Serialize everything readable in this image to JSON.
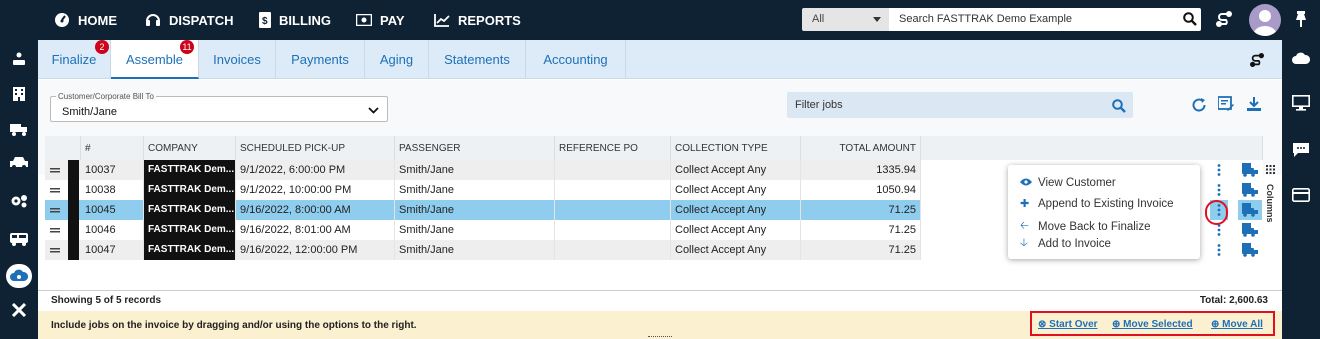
{
  "topnav": {
    "items": [
      {
        "label": "HOME",
        "icon": "speedometer-icon"
      },
      {
        "label": "DISPATCH",
        "icon": "headset-icon"
      },
      {
        "label": "BILLING",
        "icon": "document-dollar-icon"
      },
      {
        "label": "PAY",
        "icon": "money-icon"
      },
      {
        "label": "REPORTS",
        "icon": "chart-line-icon"
      }
    ],
    "search_category": "All",
    "search_placeholder": "Search FASTTRAK Demo Example"
  },
  "tabs": [
    {
      "label": "Finalize",
      "badge": "2"
    },
    {
      "label": "Assemble",
      "badge": "11",
      "active": true
    },
    {
      "label": "Invoices"
    },
    {
      "label": "Payments"
    },
    {
      "label": "Aging"
    },
    {
      "label": "Statements"
    },
    {
      "label": "Accounting"
    }
  ],
  "filters": {
    "customer_label": "Customer/Corporate Bill To",
    "customer_value": "Smith/Jane",
    "filter_placeholder": "Filter jobs"
  },
  "grid": {
    "columns": [
      "#",
      "COMPANY",
      "SCHEDULED PICK-UP",
      "PASSENGER",
      "REFERENCE PO",
      "COLLECTION TYPE",
      "TOTAL AMOUNT"
    ],
    "rows": [
      {
        "id": "10037",
        "company": "FASTTRAK Dem...",
        "pickup": "9/1/2022, 6:00:00 PM",
        "passenger": "Smith/Jane",
        "ref": "",
        "collection": "Collect Accept Any",
        "amount": "1335.94"
      },
      {
        "id": "10038",
        "company": "FASTTRAK Dem...",
        "pickup": "9/1/2022, 10:00:00 PM",
        "passenger": "Smith/Jane",
        "ref": "",
        "collection": "Collect Accept Any",
        "amount": "1050.94"
      },
      {
        "id": "10045",
        "company": "FASTTRAK Dem...",
        "pickup": "9/16/2022, 8:00:00 AM",
        "passenger": "Smith/Jane",
        "ref": "",
        "collection": "Collect Accept Any",
        "amount": "71.25",
        "selected": true
      },
      {
        "id": "10046",
        "company": "FASTTRAK Dem...",
        "pickup": "9/16/2022, 8:01:00 AM",
        "passenger": "Smith/Jane",
        "ref": "",
        "collection": "Collect Accept Any",
        "amount": "71.25"
      },
      {
        "id": "10047",
        "company": "FASTTRAK Dem...",
        "pickup": "9/16/2022, 12:00:00 PM",
        "passenger": "Smith/Jane",
        "ref": "",
        "collection": "Collect Accept Any",
        "amount": "71.25"
      }
    ],
    "columns_label": "Columns"
  },
  "context_menu": [
    {
      "label": "View Customer",
      "icon": "eye-icon"
    },
    {
      "label": "Append to Existing Invoice",
      "icon": "plus-icon"
    },
    {
      "label": "Move Back to Finalize",
      "icon": "arrow-left-icon"
    },
    {
      "label": "Add to Invoice",
      "icon": "arrow-down-icon"
    }
  ],
  "footer": {
    "records": "Showing 5 of 5 records",
    "total": "Total: 2,600.63",
    "hint": "Include jobs on the invoice by dragging and/or using the options to the right.",
    "actions": [
      "Start Over",
      "Move Selected",
      "Move All"
    ]
  },
  "colors": {
    "navy": "#0f2233",
    "accent": "#1d70b8",
    "selected_row": "#8fcdee",
    "highlight": "#e0101e"
  }
}
